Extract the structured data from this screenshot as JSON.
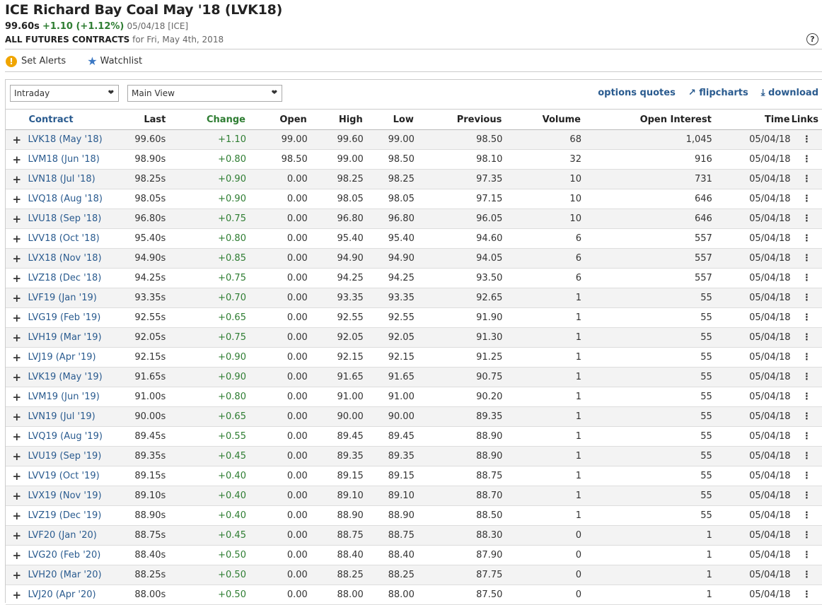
{
  "header": {
    "title": "ICE Richard Bay Coal May '18 (LVK18)",
    "last": "99.60s",
    "change": "+1.10 (+1.12%)",
    "meta": "05/04/18 [ICE]",
    "subtitle_bold": "ALL FUTURES CONTRACTS",
    "subtitle_rest": " for Fri, May 4th, 2018",
    "help": "?"
  },
  "actions": {
    "alerts": "Set Alerts",
    "watchlist": "Watchlist"
  },
  "controls": {
    "period": "Intraday",
    "view": "Main View",
    "options_quotes": "options quotes",
    "flipcharts": "flipcharts",
    "download": "download"
  },
  "table": {
    "headers": [
      "Contract",
      "Last",
      "Change",
      "Open",
      "High",
      "Low",
      "Previous",
      "Volume",
      "Open Interest",
      "Time",
      "Links"
    ],
    "rows": [
      [
        "LVK18 (May '18)",
        "99.60s",
        "+1.10",
        "99.00",
        "99.60",
        "99.00",
        "98.50",
        "68",
        "1,045",
        "05/04/18"
      ],
      [
        "LVM18 (Jun '18)",
        "98.90s",
        "+0.80",
        "98.50",
        "99.00",
        "98.50",
        "98.10",
        "32",
        "916",
        "05/04/18"
      ],
      [
        "LVN18 (Jul '18)",
        "98.25s",
        "+0.90",
        "0.00",
        "98.25",
        "98.25",
        "97.35",
        "10",
        "731",
        "05/04/18"
      ],
      [
        "LVQ18 (Aug '18)",
        "98.05s",
        "+0.90",
        "0.00",
        "98.05",
        "98.05",
        "97.15",
        "10",
        "646",
        "05/04/18"
      ],
      [
        "LVU18 (Sep '18)",
        "96.80s",
        "+0.75",
        "0.00",
        "96.80",
        "96.80",
        "96.05",
        "10",
        "646",
        "05/04/18"
      ],
      [
        "LVV18 (Oct '18)",
        "95.40s",
        "+0.80",
        "0.00",
        "95.40",
        "95.40",
        "94.60",
        "6",
        "557",
        "05/04/18"
      ],
      [
        "LVX18 (Nov '18)",
        "94.90s",
        "+0.85",
        "0.00",
        "94.90",
        "94.90",
        "94.05",
        "6",
        "557",
        "05/04/18"
      ],
      [
        "LVZ18 (Dec '18)",
        "94.25s",
        "+0.75",
        "0.00",
        "94.25",
        "94.25",
        "93.50",
        "6",
        "557",
        "05/04/18"
      ],
      [
        "LVF19 (Jan '19)",
        "93.35s",
        "+0.70",
        "0.00",
        "93.35",
        "93.35",
        "92.65",
        "1",
        "55",
        "05/04/18"
      ],
      [
        "LVG19 (Feb '19)",
        "92.55s",
        "+0.65",
        "0.00",
        "92.55",
        "92.55",
        "91.90",
        "1",
        "55",
        "05/04/18"
      ],
      [
        "LVH19 (Mar '19)",
        "92.05s",
        "+0.75",
        "0.00",
        "92.05",
        "92.05",
        "91.30",
        "1",
        "55",
        "05/04/18"
      ],
      [
        "LVJ19 (Apr '19)",
        "92.15s",
        "+0.90",
        "0.00",
        "92.15",
        "92.15",
        "91.25",
        "1",
        "55",
        "05/04/18"
      ],
      [
        "LVK19 (May '19)",
        "91.65s",
        "+0.90",
        "0.00",
        "91.65",
        "91.65",
        "90.75",
        "1",
        "55",
        "05/04/18"
      ],
      [
        "LVM19 (Jun '19)",
        "91.00s",
        "+0.80",
        "0.00",
        "91.00",
        "91.00",
        "90.20",
        "1",
        "55",
        "05/04/18"
      ],
      [
        "LVN19 (Jul '19)",
        "90.00s",
        "+0.65",
        "0.00",
        "90.00",
        "90.00",
        "89.35",
        "1",
        "55",
        "05/04/18"
      ],
      [
        "LVQ19 (Aug '19)",
        "89.45s",
        "+0.55",
        "0.00",
        "89.45",
        "89.45",
        "88.90",
        "1",
        "55",
        "05/04/18"
      ],
      [
        "LVU19 (Sep '19)",
        "89.35s",
        "+0.45",
        "0.00",
        "89.35",
        "89.35",
        "88.90",
        "1",
        "55",
        "05/04/18"
      ],
      [
        "LVV19 (Oct '19)",
        "89.15s",
        "+0.40",
        "0.00",
        "89.15",
        "89.15",
        "88.75",
        "1",
        "55",
        "05/04/18"
      ],
      [
        "LVX19 (Nov '19)",
        "89.10s",
        "+0.40",
        "0.00",
        "89.10",
        "89.10",
        "88.70",
        "1",
        "55",
        "05/04/18"
      ],
      [
        "LVZ19 (Dec '19)",
        "88.90s",
        "+0.40",
        "0.00",
        "88.90",
        "88.90",
        "88.50",
        "1",
        "55",
        "05/04/18"
      ],
      [
        "LVF20 (Jan '20)",
        "88.75s",
        "+0.45",
        "0.00",
        "88.75",
        "88.75",
        "88.30",
        "0",
        "1",
        "05/04/18"
      ],
      [
        "LVG20 (Feb '20)",
        "88.40s",
        "+0.50",
        "0.00",
        "88.40",
        "88.40",
        "87.90",
        "0",
        "1",
        "05/04/18"
      ],
      [
        "LVH20 (Mar '20)",
        "88.25s",
        "+0.50",
        "0.00",
        "88.25",
        "88.25",
        "87.75",
        "0",
        "1",
        "05/04/18"
      ],
      [
        "LVJ20 (Apr '20)",
        "88.00s",
        "+0.50",
        "0.00",
        "88.00",
        "88.00",
        "87.50",
        "0",
        "1",
        "05/04/18"
      ]
    ]
  },
  "icons": {
    "expand": "plus-icon",
    "links": "kebab-menu-icon"
  }
}
